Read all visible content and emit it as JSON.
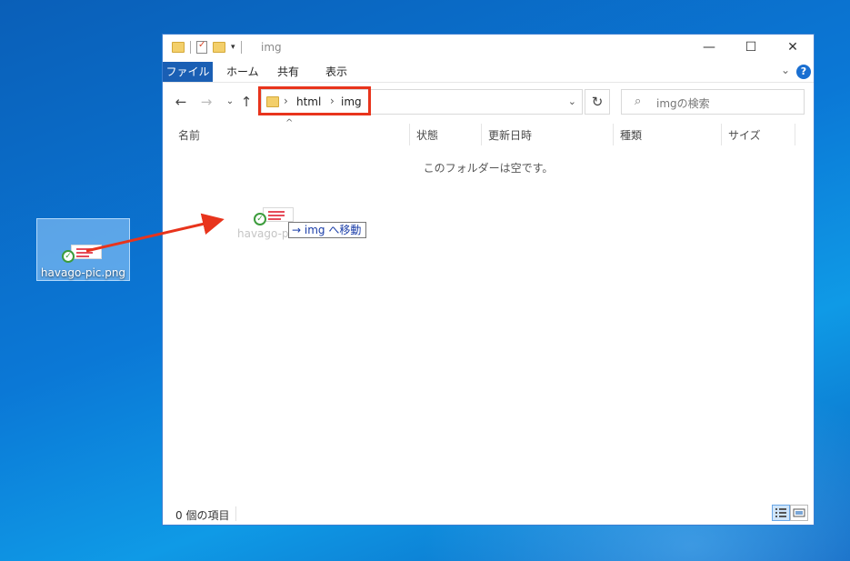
{
  "desktop": {
    "file_icon_label": "havago-pic.png",
    "file_icon_name": "png-file-icon"
  },
  "window": {
    "title": "img",
    "ribbon_tabs": {
      "file": "ファイル",
      "home": "ホーム",
      "share": "共有",
      "view": "表示"
    },
    "address": {
      "crumbs": [
        "html",
        "img"
      ]
    },
    "search": {
      "placeholder": "imgの検索"
    },
    "columns": {
      "name": "名前",
      "status": "状態",
      "modified": "更新日時",
      "type": "種類",
      "size": "サイズ"
    },
    "empty_message": "このフォルダーは空です。",
    "drag": {
      "ghost_label": "havago-pi",
      "tooltip": "img へ移動",
      "tooltip_arrow": "→"
    },
    "status_bar": {
      "item_count": "0 個の項目"
    },
    "colors": {
      "accent": "#1a5fb4",
      "highlight_box": "#e8341c",
      "arrow": "#e8341c"
    }
  }
}
